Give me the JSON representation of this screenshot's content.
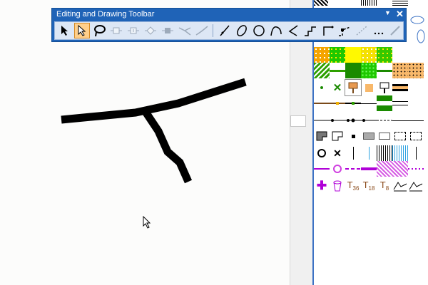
{
  "toolbar": {
    "title": "Editing and Drawing Toolbar",
    "menu_glyph": "▼",
    "close_glyph": "✕",
    "tools": [
      {
        "name": "select-arrow-icon",
        "active": false
      },
      {
        "name": "select-hollow-arrow-icon",
        "active": true
      },
      {
        "name": "lasso-icon",
        "active": false
      },
      {
        "name": "node-move-icon",
        "active": false
      },
      {
        "name": "node-add-icon",
        "active": false
      },
      {
        "name": "node-diamond-icon",
        "active": false
      },
      {
        "name": "node-delete-icon",
        "active": false
      },
      {
        "name": "split-line-icon",
        "active": false
      },
      {
        "name": "smooth-line-icon",
        "active": false
      },
      {
        "name": "straight-line-icon",
        "active": false
      },
      {
        "name": "ellipse-icon",
        "active": false
      },
      {
        "name": "circle-icon",
        "active": false
      },
      {
        "name": "curve-icon",
        "active": false
      },
      {
        "name": "angle-icon",
        "active": false
      },
      {
        "name": "step-line-icon",
        "active": false
      },
      {
        "name": "rect-line-icon",
        "active": false
      },
      {
        "name": "dash-step-icon",
        "active": false
      },
      {
        "name": "dotted-line-icon",
        "active": false
      },
      {
        "name": "ellipsis-icon",
        "active": false
      },
      {
        "name": "pen-icon",
        "active": false
      }
    ]
  },
  "palette": {
    "accent": "#3c72c4",
    "text_symbols": [
      "T36",
      "T18",
      "T8"
    ]
  },
  "colors": {
    "toolbar_bg": "#1f63b7",
    "toolbar_body": "#dde7f5",
    "active_tool": "#ffcf8a"
  }
}
